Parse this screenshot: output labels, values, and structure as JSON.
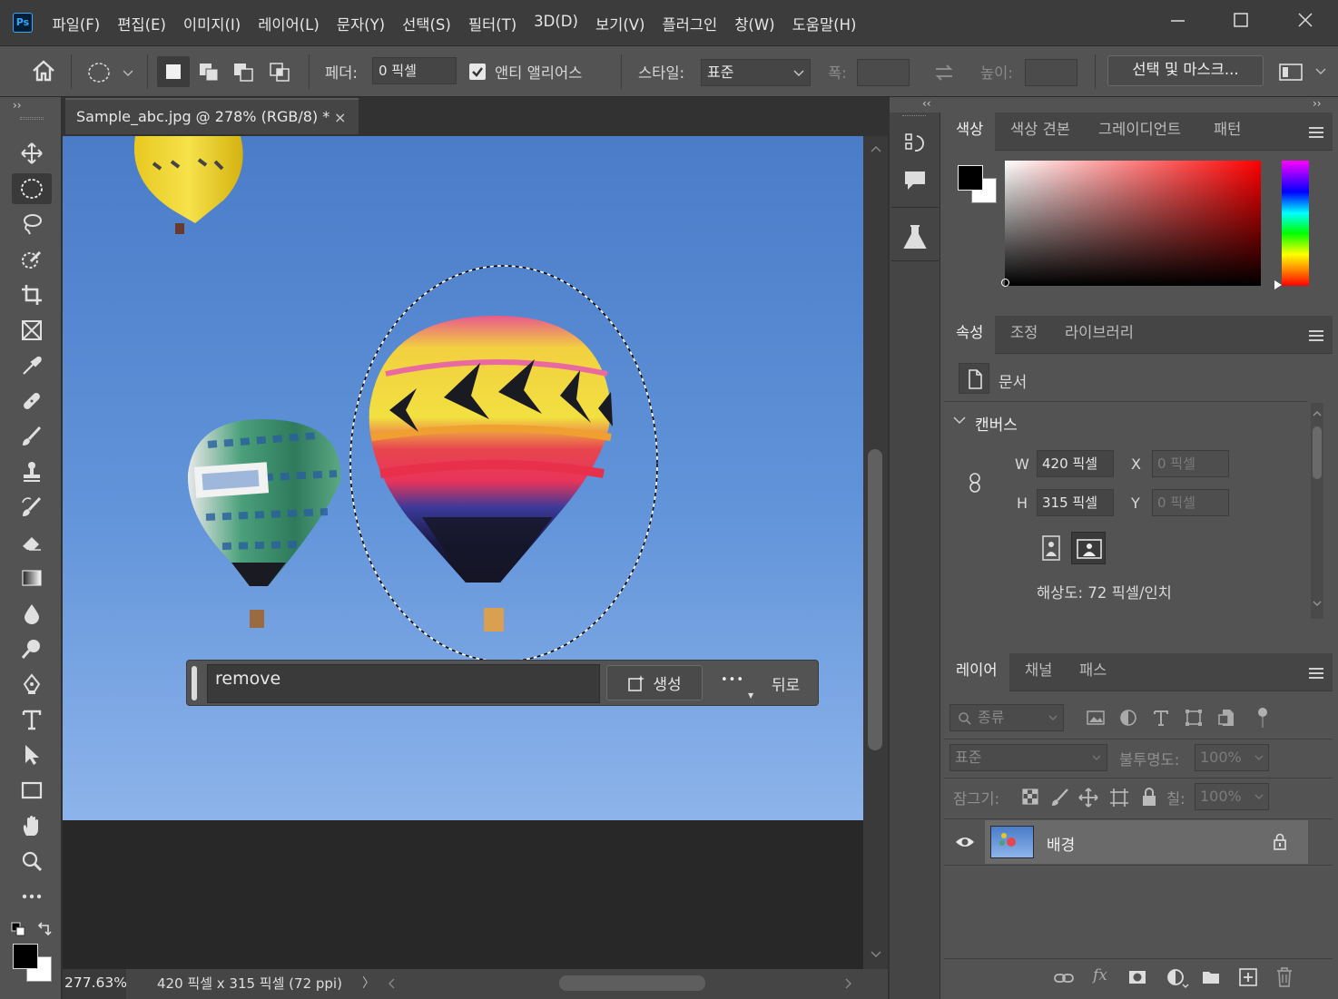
{
  "app": {
    "logo": "Ps"
  },
  "menu": [
    "파일(F)",
    "편집(E)",
    "이미지(I)",
    "레이어(L)",
    "문자(Y)",
    "선택(S)",
    "필터(T)",
    "3D(D)",
    "보기(V)",
    "플러그인",
    "창(W)",
    "도움말(H)"
  ],
  "options": {
    "feather_label": "페더:",
    "feather_value": "0 픽셀",
    "antialias_label": "앤티 앨리어스",
    "style_label": "스타일:",
    "style_value": "표준",
    "width_label": "폭:",
    "height_label": "높이:",
    "select_mask_label": "선택 및 마스크..."
  },
  "document": {
    "tab_title": "Sample_abc.jpg @ 278% (RGB/8) *",
    "close_glyph": "×"
  },
  "genfill": {
    "prompt_value": "remove",
    "generate_label": "생성",
    "more_glyph": "•••",
    "back_label": "뒤로"
  },
  "status": {
    "zoom": "277.63%",
    "doc_info": "420 픽셀 x 315 픽셀 (72 ppi)",
    "arrow": "〉"
  },
  "color_panel": {
    "tabs": [
      "색상",
      "색상 견본",
      "그레이디언트",
      "패턴"
    ]
  },
  "properties_panel": {
    "tabs": [
      "속성",
      "조정",
      "라이브러리"
    ],
    "doc_label": "문서",
    "canvas_label": "캔버스",
    "w_label": "W",
    "w_value": "420 픽셀",
    "h_label": "H",
    "h_value": "315 픽셀",
    "x_label": "X",
    "x_value": "0 픽셀",
    "y_label": "Y",
    "y_value": "0 픽셀",
    "resolution": "해상도: 72 픽셀/인치"
  },
  "layers_panel": {
    "tabs": [
      "레이어",
      "채널",
      "패스"
    ],
    "filter_label": "종류",
    "blend_mode": "표준",
    "opacity_label": "불투명도:",
    "opacity_value": "100%",
    "lock_label": "잠그기:",
    "fill_label": "칠:",
    "fill_value": "100%",
    "layer_name": "배경"
  },
  "colors": {
    "accent": "#31a8ff",
    "panel": "#535353",
    "foreground": "#000000",
    "background": "#ffffff"
  }
}
